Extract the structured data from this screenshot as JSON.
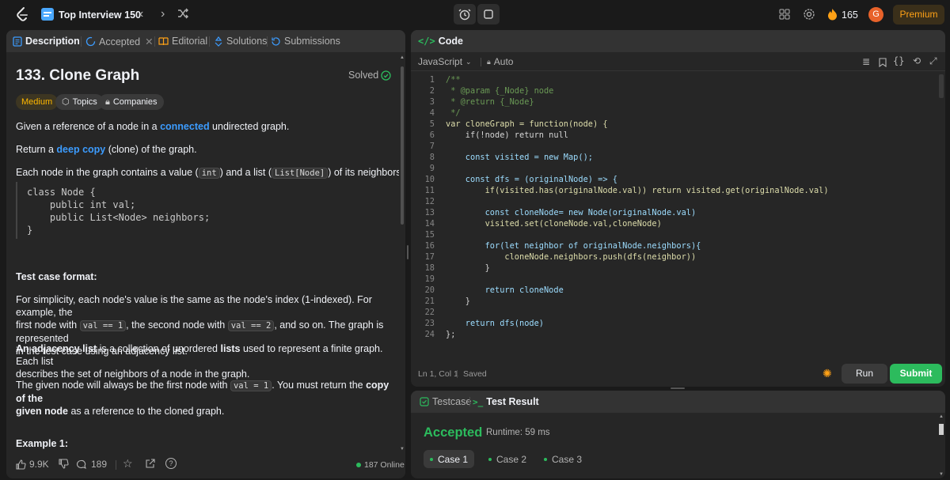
{
  "topbar": {
    "list_title": "Top Interview 150",
    "streak_count": "165",
    "avatar_letter": "G",
    "premium_label": "Premium"
  },
  "tabs": {
    "description": "Description",
    "accepted": "Accepted",
    "editorial": "Editorial",
    "solutions": "Solutions",
    "submissions": "Submissions"
  },
  "problem": {
    "title": "133. Clone Graph",
    "status": "Solved",
    "difficulty": "Medium",
    "topics": "Topics",
    "companies": "Companies",
    "p1a": "Given a reference of a node in a ",
    "p1link": "connected",
    "p1b": " undirected graph.",
    "p2a": "Return a ",
    "p2link": "deep copy",
    "p2b": " (clone) of the graph.",
    "p3a": "Each node in the graph contains a value (",
    "p3c1": "int",
    "p3b": ") and a list (",
    "p3c2": "List[Node]",
    "p3c": ") of its neighbors.",
    "class_code": [
      "class Node {",
      "    public int val;",
      "    public List<Node> neighbors;",
      "}"
    ],
    "tcf_heading": "Test case format:",
    "tcf_a": "For simplicity, each node's value is the same as the node's index (1-indexed). For example, the",
    "tcf_b": "first node with ",
    "tcf_c1": "val == 1",
    "tcf_c": ", the second node with ",
    "tcf_c2": "val == 2",
    "tcf_d": ", and so on. The graph is represented",
    "tcf_e": "in the test case using an adjacency list.",
    "adj_bold1": "An adjacency list",
    "adj_a": " is a collection of unordered ",
    "adj_bold2": "lists",
    "adj_b": " used to represent a finite graph. Each list",
    "adj_c": "describes the set of neighbors of a node in the graph.",
    "given_a": "The given node will always be the first node with ",
    "given_code": "val = 1",
    "given_b": ". You must return the ",
    "given_bold": "copy of the",
    "given_bold2": "given node",
    "given_c": " as a reference to the cloned graph.",
    "example_heading": "Example 1:"
  },
  "footer": {
    "likes": "9.9K",
    "comments": "189",
    "online": "187 Online"
  },
  "editor": {
    "header_label": "Code",
    "language": "JavaScript",
    "mode": "Auto",
    "status_pos": "Ln 1, Col 1",
    "status_saved": "Saved",
    "run_label": "Run",
    "submit_label": "Submit",
    "lines": [
      {
        "n": "1",
        "t": "/**"
      },
      {
        "n": "2",
        "t": " * @param {_Node} node"
      },
      {
        "n": "3",
        "t": " * @return {_Node}"
      },
      {
        "n": "4",
        "t": " */"
      },
      {
        "n": "5",
        "t": "var cloneGraph = function(node) {"
      },
      {
        "n": "6",
        "t": "    if(!node) return null"
      },
      {
        "n": "7",
        "t": ""
      },
      {
        "n": "8",
        "t": "    const visited = new Map();"
      },
      {
        "n": "9",
        "t": ""
      },
      {
        "n": "10",
        "t": "    const dfs = (originalNode) => {"
      },
      {
        "n": "11",
        "t": "        if(visited.has(originalNode.val)) return visited.get(originalNode.val)"
      },
      {
        "n": "12",
        "t": ""
      },
      {
        "n": "13",
        "t": "        const cloneNode= new Node(originalNode.val)"
      },
      {
        "n": "14",
        "t": "        visited.set(cloneNode.val,cloneNode)"
      },
      {
        "n": "15",
        "t": ""
      },
      {
        "n": "16",
        "t": "        for(let neighbor of originalNode.neighbors){"
      },
      {
        "n": "17",
        "t": "            cloneNode.neighbors.push(dfs(neighbor))"
      },
      {
        "n": "18",
        "t": "        }"
      },
      {
        "n": "19",
        "t": ""
      },
      {
        "n": "20",
        "t": "        return cloneNode"
      },
      {
        "n": "21",
        "t": "    }"
      },
      {
        "n": "22",
        "t": ""
      },
      {
        "n": "23",
        "t": "    return dfs(node)"
      },
      {
        "n": "24",
        "t": "};"
      }
    ]
  },
  "result": {
    "testcase_tab": "Testcase",
    "result_tab": "Test Result",
    "verdict": "Accepted",
    "runtime": "Runtime: 59 ms",
    "cases": [
      "Case 1",
      "Case 2",
      "Case 3"
    ]
  },
  "colors": {
    "accent": "#ffa116",
    "accepted": "#2cbb5d",
    "link": "#3c9cff",
    "medium": "#ffb800"
  }
}
